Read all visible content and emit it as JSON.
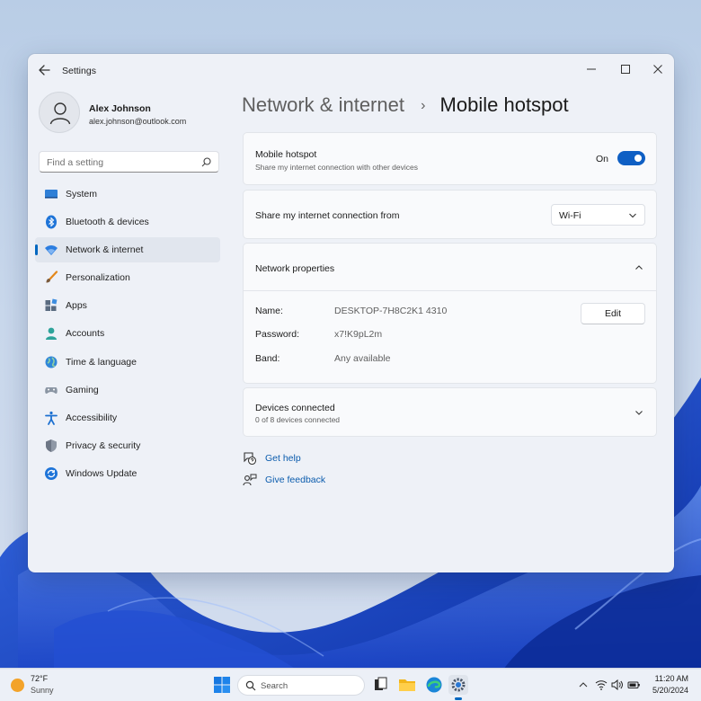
{
  "window": {
    "title": "Settings"
  },
  "profile": {
    "name": "Alex Johnson",
    "email": "alex.johnson@outlook.com"
  },
  "search": {
    "placeholder": "Find a setting"
  },
  "sidebar": {
    "items": [
      {
        "label": "System",
        "icon": "monitor-icon"
      },
      {
        "label": "Bluetooth & devices",
        "icon": "bluetooth-icon"
      },
      {
        "label": "Network & internet",
        "icon": "wifi-icon",
        "active": true
      },
      {
        "label": "Personalization",
        "icon": "brush-icon"
      },
      {
        "label": "Apps",
        "icon": "apps-icon"
      },
      {
        "label": "Accounts",
        "icon": "person-icon"
      },
      {
        "label": "Time & language",
        "icon": "globe-icon"
      },
      {
        "label": "Gaming",
        "icon": "gamepad-icon"
      },
      {
        "label": "Accessibility",
        "icon": "accessibility-icon"
      },
      {
        "label": "Privacy & security",
        "icon": "shield-icon"
      },
      {
        "label": "Windows Update",
        "icon": "update-icon"
      }
    ]
  },
  "breadcrumb": {
    "parent": "Network & internet",
    "separator": "›",
    "current": "Mobile hotspot"
  },
  "hotspot": {
    "title": "Mobile hotspot",
    "subtitle": "Share my internet connection with other devices",
    "state": "On",
    "enabled": true
  },
  "share_from": {
    "label": "Share my internet connection from",
    "value": "Wi-Fi"
  },
  "network_properties": {
    "title": "Network properties",
    "expanded": true,
    "name_label": "Name:",
    "name_value": "DESKTOP-7H8C2K1 4310",
    "password_label": "Password:",
    "password_value": "x7!K9pL2m",
    "band_label": "Band:",
    "band_value": "Any available",
    "edit_label": "Edit"
  },
  "devices": {
    "title": "Devices connected",
    "subtitle": "0 of 8 devices connected",
    "expanded": false
  },
  "links": {
    "help": "Get help",
    "feedback": "Give feedback"
  },
  "taskbar": {
    "weather_temp": "72°F",
    "weather_condition": "Sunny",
    "search_placeholder": "Search",
    "time": "11:20 AM",
    "date": "5/20/2024"
  },
  "colors": {
    "accent": "#0067c0",
    "toggle_on": "#0f5fc4",
    "link": "#0b5cad"
  }
}
